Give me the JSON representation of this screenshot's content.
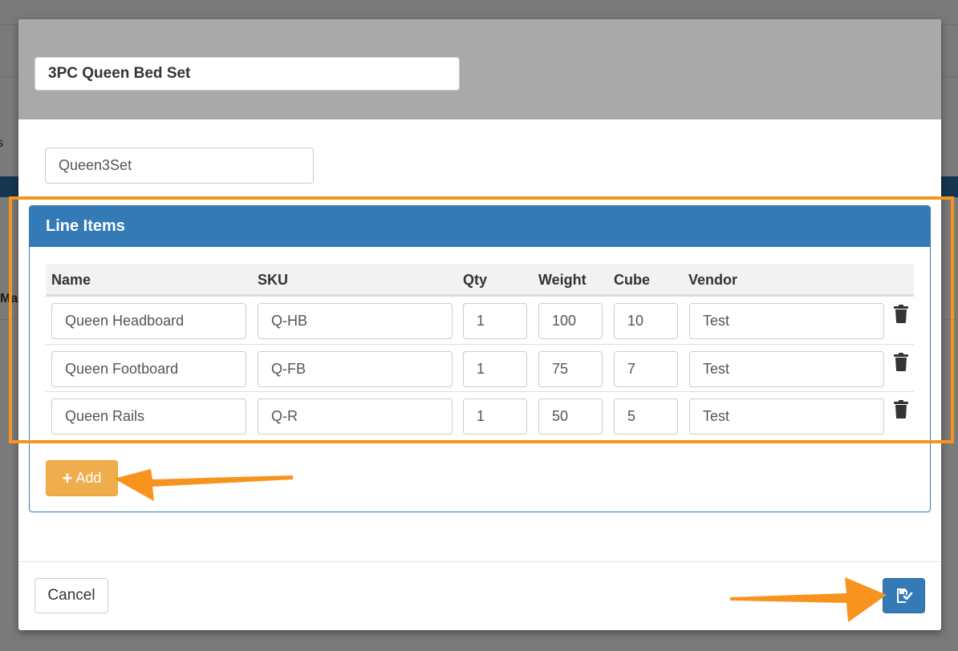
{
  "background": {
    "side_text_1": "s",
    "side_text_2": "Ma"
  },
  "header": {
    "title_value": "3PC Queen Bed Set"
  },
  "form": {
    "code_value": "Queen3Set"
  },
  "line_items": {
    "heading": "Line Items",
    "columns": [
      "Name",
      "SKU",
      "Qty",
      "Weight",
      "Cube",
      "Vendor"
    ],
    "rows": [
      {
        "name": "Queen Headboard",
        "sku": "Q-HB",
        "qty": "1",
        "weight": "100",
        "cube": "10",
        "vendor": "Test"
      },
      {
        "name": "Queen Footboard",
        "sku": "Q-FB",
        "qty": "1",
        "weight": "75",
        "cube": "7",
        "vendor": "Test"
      },
      {
        "name": "Queen Rails",
        "sku": "Q-R",
        "qty": "1",
        "weight": "50",
        "cube": "5",
        "vendor": "Test"
      }
    ],
    "add_label": "Add",
    "row_action_icon": "trash-icon"
  },
  "footer": {
    "cancel_label": "Cancel",
    "save_icon": "save-icon"
  },
  "colors": {
    "primary": "#337ab7",
    "warning": "#f0ad4e",
    "annotation": "#f7931e",
    "header_bg": "#a9a9a9"
  }
}
